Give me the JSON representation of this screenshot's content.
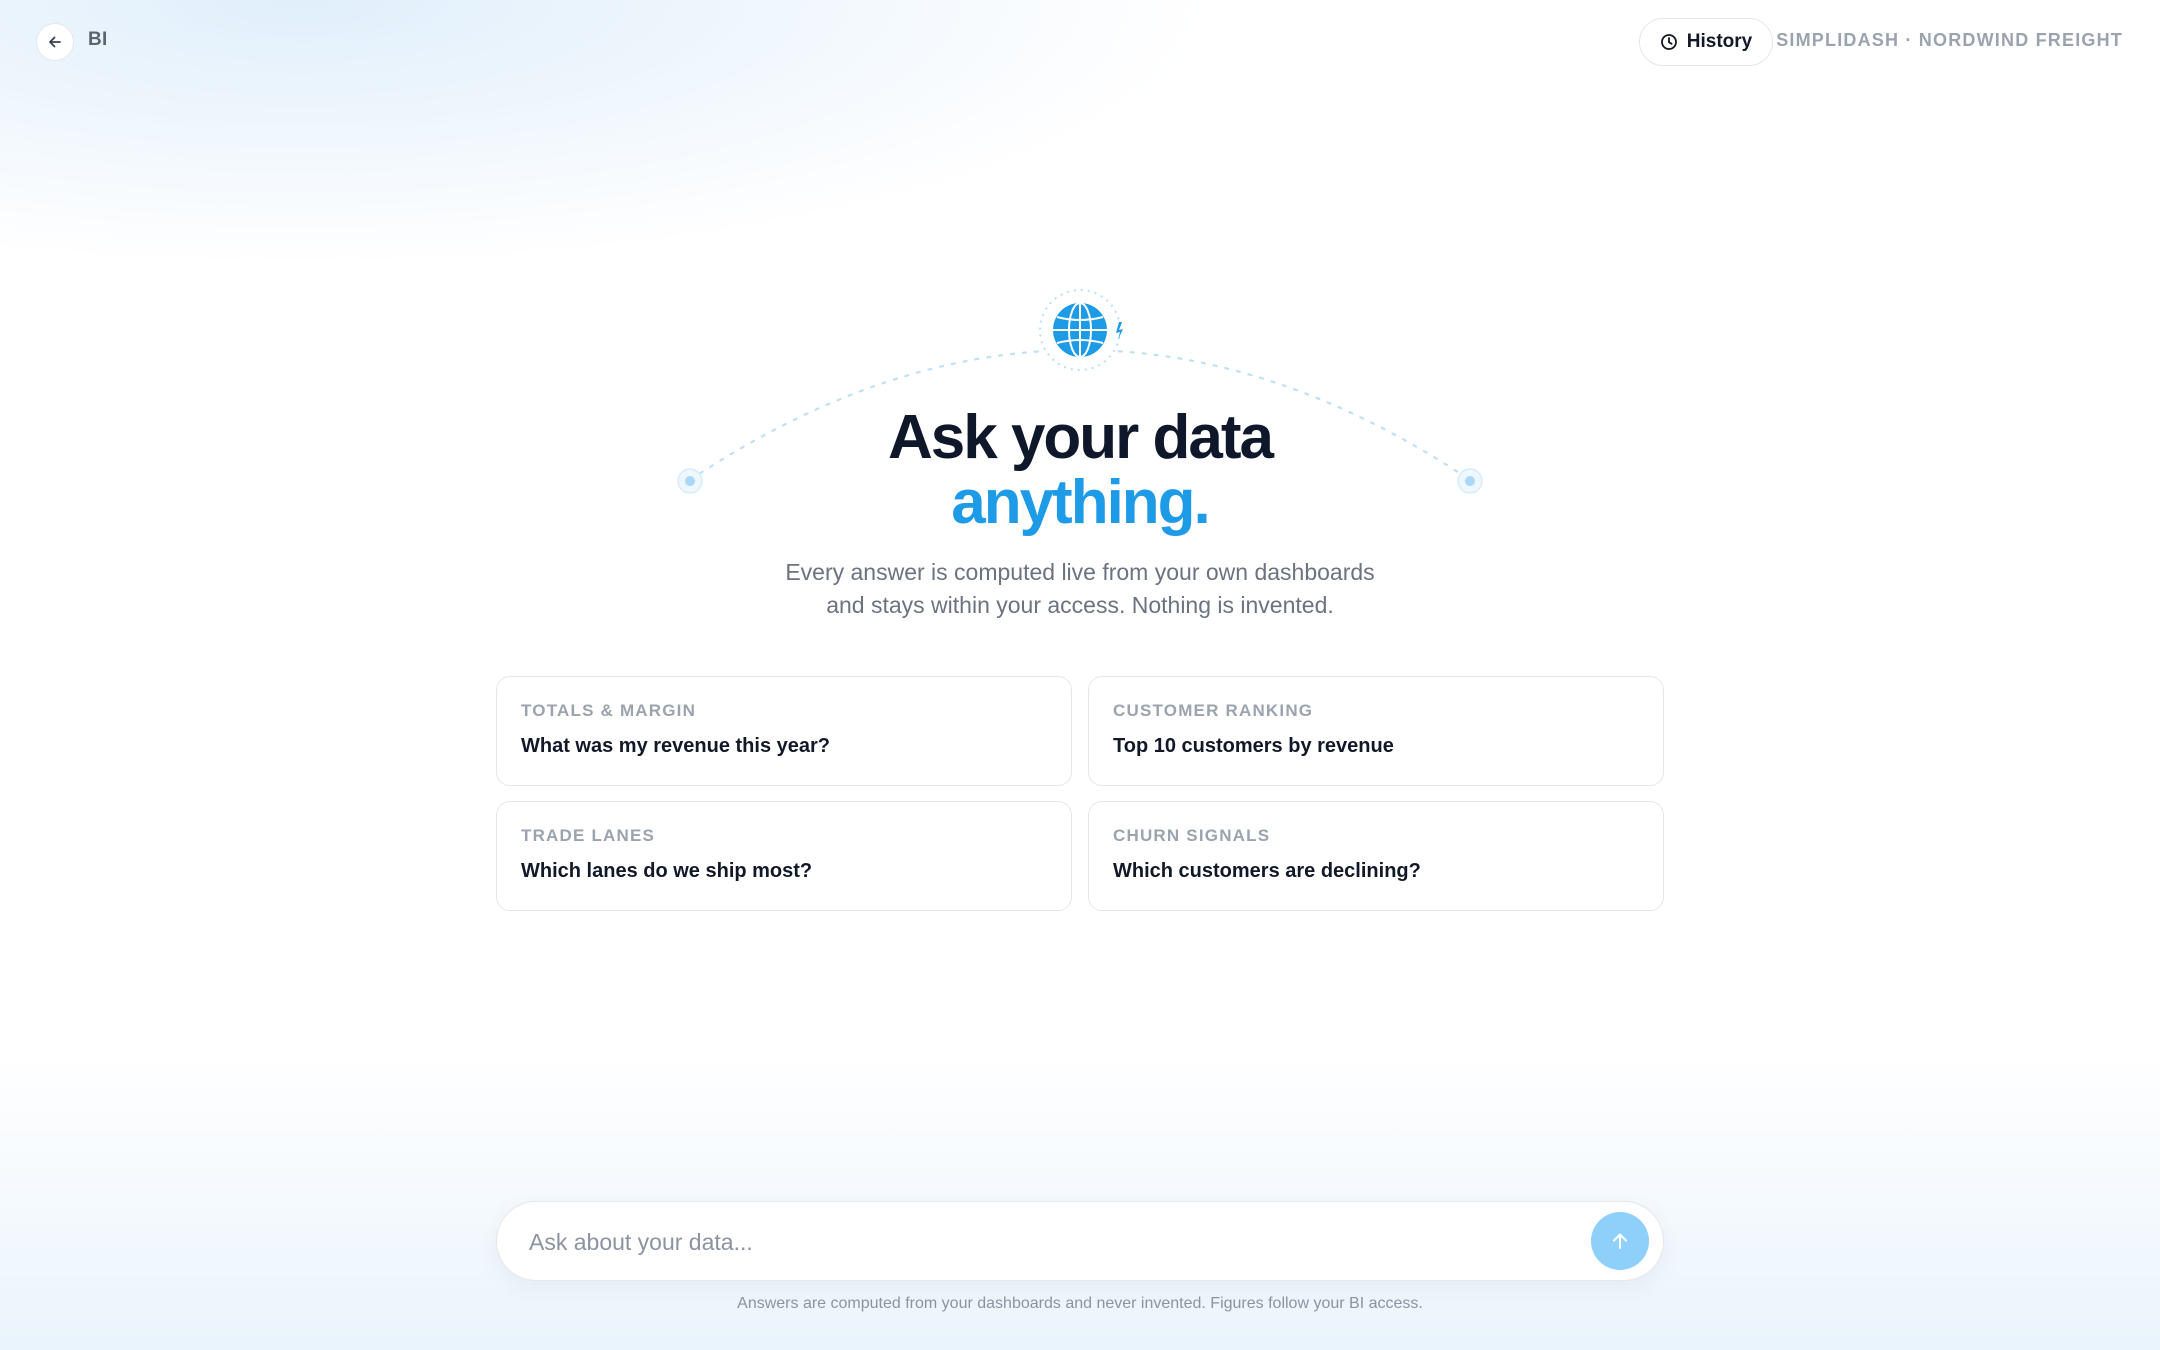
{
  "topbar": {
    "back_icon": "arrow-left-icon",
    "section_label": "BI",
    "history_label": "History",
    "history_icon": "clock-icon",
    "brand_text": "SIMPLIDASH · NORDWIND FREIGHT"
  },
  "hero": {
    "icon": "globe-icon",
    "title_line1": "Ask your data",
    "title_line2": "anything.",
    "subtitle_line1": "Every answer is computed live from your own dashboards",
    "subtitle_line2": "and stays within your access. Nothing is invented."
  },
  "suggestions": [
    {
      "category": "TOTALS & MARGIN",
      "question": "What was my revenue this year?"
    },
    {
      "category": "CUSTOMER RANKING",
      "question": "Top 10 customers by revenue"
    },
    {
      "category": "TRADE LANES",
      "question": "Which lanes do we ship most?"
    },
    {
      "category": "CHURN SIGNALS",
      "question": "Which customers are declining?"
    }
  ],
  "composer": {
    "placeholder": "Ask about your data...",
    "value": "",
    "send_icon": "arrow-up-icon"
  },
  "footnote": "Answers are computed from your dashboards and never invented. Figures follow your BI access.",
  "colors": {
    "accent": "#1e9be6",
    "title": "#0f172a",
    "muted": "#9aa3ae",
    "send_button": "#8fd0fa"
  }
}
